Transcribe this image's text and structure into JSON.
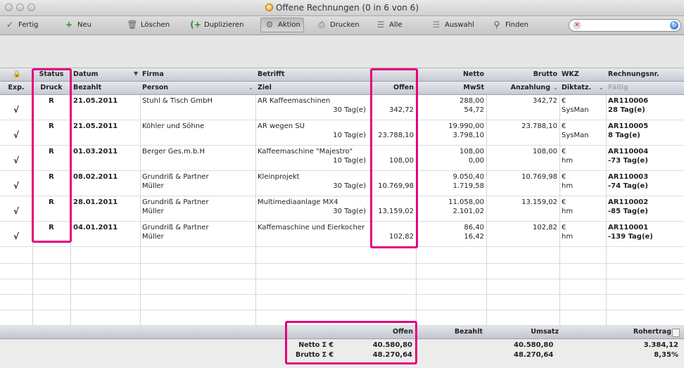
{
  "window": {
    "title": "Offene Rechnungen (0 in 6 von 6)"
  },
  "toolbar": {
    "fertig": "Fertig",
    "neu": "Neu",
    "loeschen": "Löschen",
    "duplizieren": "Duplizieren",
    "aktion": "Aktion",
    "drucken": "Drucken",
    "alle": "Alle",
    "auswahl": "Auswahl",
    "finden": "Finden",
    "search_value": ""
  },
  "columns": {
    "top": {
      "status": "Status",
      "datum": "Datum",
      "firma": "Firma",
      "betrifft": "Betrifft",
      "netto": "Netto",
      "brutto": "Brutto",
      "wkz": "WKZ",
      "rechnungsnr": "Rechnungsnr."
    },
    "bottom": {
      "exp": "Exp.",
      "druck": "Druck",
      "bezahlt": "Bezahlt",
      "person": "Person",
      "ziel": "Ziel",
      "offen": "Offen",
      "mwst": "MwSt",
      "anzahlung": "Anzahlung",
      "diktatz": "Diktatz.",
      "faellig": "Fällig"
    }
  },
  "rows": [
    {
      "exp": "√",
      "status": "R",
      "datum": "21.05.2011",
      "firma": "Stuhl & Tisch GmbH",
      "person": "",
      "betrifft": "AR Kaffeemaschinen",
      "ziel": "30 Tag(e)",
      "offen": "342,72",
      "netto": "288,00",
      "mwst": "54,72",
      "brutto": "342,72",
      "anzahlung": "",
      "wkz": "€",
      "diktatz": "SysMan",
      "nr": "AR110006",
      "faellig": "28 Tag(e)"
    },
    {
      "exp": "√",
      "status": "R",
      "datum": "21.05.2011",
      "firma": "Köhler und Söhne",
      "person": "",
      "betrifft": "AR wegen SU",
      "ziel": "10 Tag(e)",
      "offen": "23.788,10",
      "netto": "19.990,00",
      "mwst": "3.798,10",
      "brutto": "23.788,10",
      "anzahlung": "",
      "wkz": "€",
      "diktatz": "SysMan",
      "nr": "AR110005",
      "faellig": "8 Tag(e)"
    },
    {
      "exp": "√",
      "status": "R",
      "datum": "01.03.2011",
      "firma": "Berger Ges.m.b.H",
      "person": "",
      "betrifft": "Kaffeemaschine \"Majestro\"",
      "ziel": "10 Tag(e)",
      "offen": "108,00",
      "netto": "108,00",
      "mwst": "0,00",
      "brutto": "108,00",
      "anzahlung": "",
      "wkz": "€",
      "diktatz": "hm",
      "nr": "AR110004",
      "faellig": "-73 Tag(e)"
    },
    {
      "exp": "√",
      "status": "R",
      "datum": "08.02.2011",
      "firma": "Grundriß & Partner",
      "person": "Müller",
      "betrifft": "Kleinprojekt",
      "ziel": "30 Tag(e)",
      "offen": "10.769,98",
      "netto": "9.050,40",
      "mwst": "1.719,58",
      "brutto": "10.769,98",
      "anzahlung": "",
      "wkz": "€",
      "diktatz": "hm",
      "nr": "AR110003",
      "faellig": "-74 Tag(e)"
    },
    {
      "exp": "√",
      "status": "R",
      "datum": "28.01.2011",
      "firma": "Grundriß & Partner",
      "person": "Müller",
      "betrifft": "Multimediaanlage MX4",
      "ziel": "30 Tag(e)",
      "offen": "13.159,02",
      "netto": "11.058,00",
      "mwst": "2.101,02",
      "brutto": "13.159,02",
      "anzahlung": "",
      "wkz": "€",
      "diktatz": "hm",
      "nr": "AR110002",
      "faellig": "-85 Tag(e)"
    },
    {
      "exp": "√",
      "status": "R",
      "datum": "04.01.2011",
      "firma": "Grundriß & Partner",
      "person": "Müller",
      "betrifft": "Kaffemaschine und Eierkocher",
      "ziel": "",
      "offen": "102,82",
      "netto": "86,40",
      "mwst": "16,42",
      "brutto": "102,82",
      "anzahlung": "",
      "wkz": "€",
      "diktatz": "hm",
      "nr": "AR110001",
      "faellig": "-139 Tag(e)"
    }
  ],
  "footer": {
    "offen_label": "Offen",
    "bezahlt_label": "Bezahlt",
    "umsatz_label": "Umsatz",
    "rohertrag_label": "Rohertrag",
    "netto_label": "Netto Σ  €",
    "brutto_label": "Brutto Σ  €",
    "netto_offen": "40.580,80",
    "brutto_offen": "48.270,64",
    "netto_umsatz": "40.580,80",
    "brutto_umsatz": "48.270,64",
    "rohertrag_value": "3.384,12",
    "rohertrag_percent": "8,35%"
  },
  "colors": {
    "highlight": "#e4007c",
    "header_gradient_top": "#e7e9ee",
    "header_gradient_bottom": "#c6cad3"
  }
}
